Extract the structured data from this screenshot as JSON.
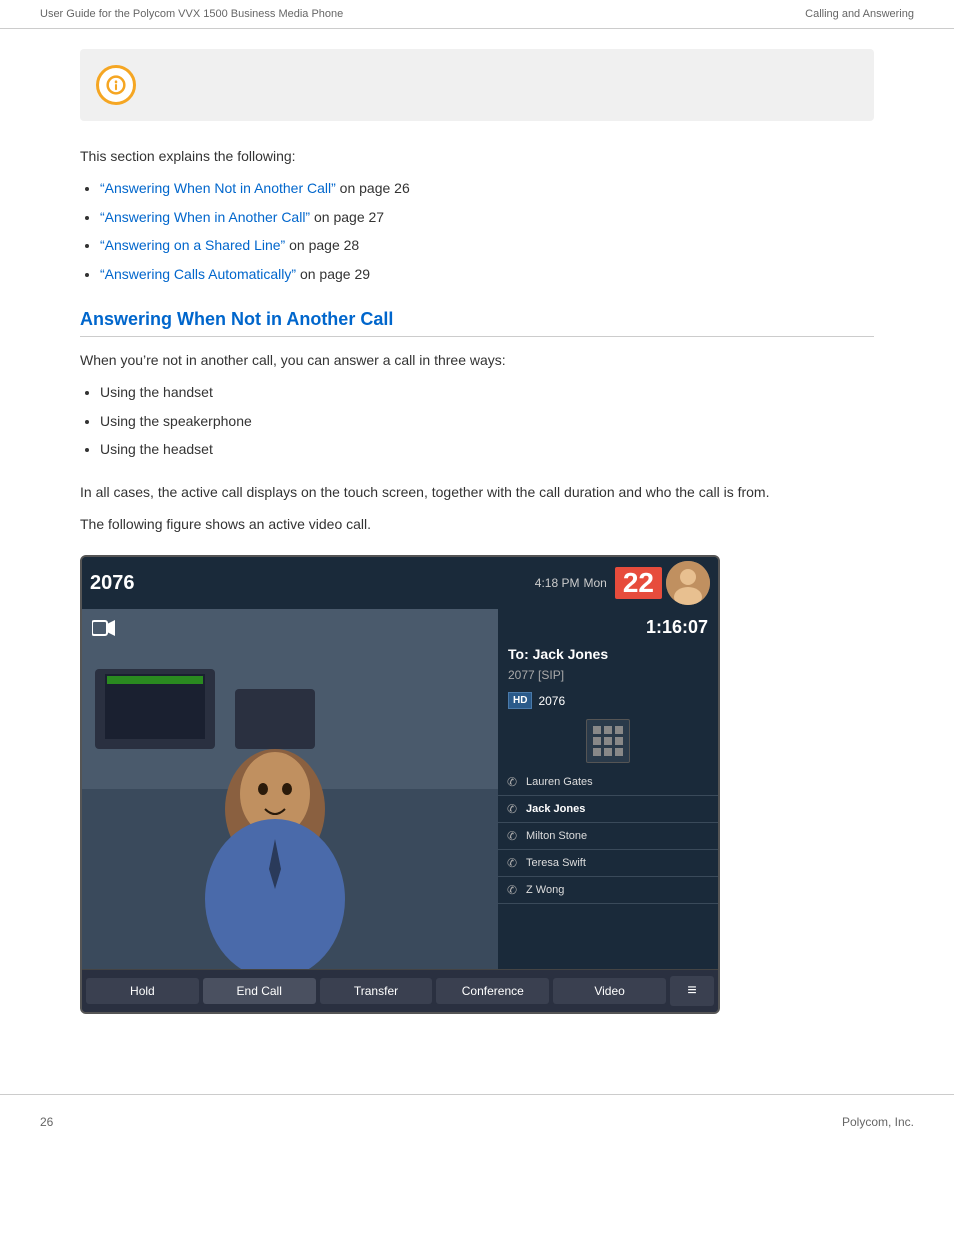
{
  "header": {
    "left": "User Guide for the Polycom VVX 1500 Business Media Phone",
    "right": "Calling and Answering"
  },
  "noteBox": {
    "iconTitle": "info-icon"
  },
  "intro": {
    "sectionTitle": "This section explains the following:",
    "links": [
      {
        "text": "“Answering When Not in Another Call”",
        "suffix": " on page 26"
      },
      {
        "text": "“Answering When in Another Call”",
        "suffix": " on page 27"
      },
      {
        "text": "“Answering on a Shared Line”",
        "suffix": " on page 28"
      },
      {
        "text": "“Answering Calls Automatically”",
        "suffix": " on page 29"
      }
    ]
  },
  "section": {
    "heading": "Answering When Not in Another Call",
    "paragraph1": "When you’re not in another call, you can answer a call in three ways:",
    "bullets": [
      "Using the handset",
      "Using the speakerphone",
      "Using the headset"
    ],
    "paragraph2": "In all cases, the active call displays on the touch screen, together with the call duration and who the call is from.",
    "paragraph3": "The following figure shows an active video call."
  },
  "phoneScreen": {
    "statusBar": {
      "time": "4:18 PM",
      "ext": "2076",
      "dayLabel": "Mon",
      "dateNum": "22"
    },
    "callInfo": {
      "timer": "1:16:07",
      "toLabel": "To: Jack Jones",
      "number": "2077 [SIP]"
    },
    "toolbar": {
      "hold": "Hold",
      "endCall": "End Call",
      "transfer": "Transfer",
      "conference": "Conference",
      "video": "Video"
    },
    "directory": {
      "headerExt": "2076",
      "items": [
        {
          "name": "Lauren Gates",
          "active": false
        },
        {
          "name": "Jack Jones",
          "active": true
        },
        {
          "name": "Milton Stone",
          "active": false
        },
        {
          "name": "Teresa Swift",
          "active": false
        },
        {
          "name": "Z Wong",
          "active": false
        }
      ]
    }
  },
  "footer": {
    "pageNum": "26",
    "company": "Polycom, Inc."
  }
}
